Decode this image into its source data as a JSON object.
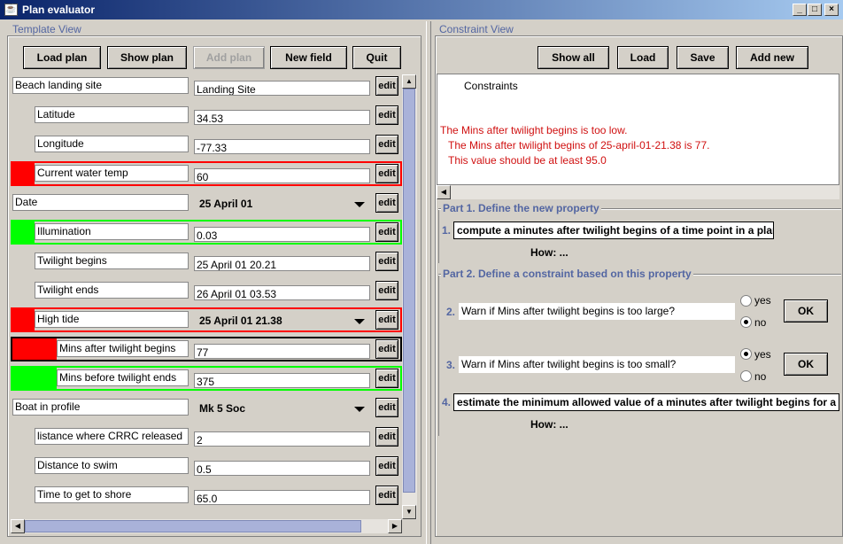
{
  "window": {
    "title": "Plan evaluator",
    "icon": "java-cup-icon"
  },
  "template_view": {
    "title": "Template View",
    "buttons": [
      "Load plan",
      "Show plan",
      "Add plan",
      "New field",
      "Quit"
    ],
    "edit_label": "edit",
    "rows": [
      {
        "label": "Beach landing site",
        "value": "Landing Site",
        "type": "text",
        "indent": 0,
        "status": "none"
      },
      {
        "label": "Latitude",
        "value": "34.53",
        "type": "text",
        "indent": 1,
        "status": "none"
      },
      {
        "label": "Longitude",
        "value": "-77.33",
        "type": "text",
        "indent": 1,
        "status": "none"
      },
      {
        "label": "Current water temp",
        "value": "60",
        "type": "text",
        "indent": 1,
        "status": "red"
      },
      {
        "label": "Date",
        "value": "25 April 01",
        "type": "combo",
        "indent": 0,
        "status": "none"
      },
      {
        "label": "Illumination",
        "value": "0.03",
        "type": "text",
        "indent": 1,
        "status": "green"
      },
      {
        "label": "Twilight begins",
        "value": "25 April 01 20.21",
        "type": "text",
        "indent": 1,
        "status": "none"
      },
      {
        "label": "Twilight ends",
        "value": "26 April 01 03.53",
        "type": "text",
        "indent": 1,
        "status": "none"
      },
      {
        "label": "High tide",
        "value": "25 April 01 21.38",
        "type": "combo",
        "indent": 1,
        "status": "red"
      },
      {
        "label": "Mins after twilight begins",
        "value": "77",
        "type": "text",
        "indent": 2,
        "status": "red-selected"
      },
      {
        "label": "Mins before twilight ends",
        "value": "375",
        "type": "text",
        "indent": 2,
        "status": "green"
      },
      {
        "label": "Boat in profile",
        "value": "Mk 5 Soc",
        "type": "combo",
        "indent": 0,
        "status": "none"
      },
      {
        "label": "listance where CRRC released",
        "value": "2",
        "type": "text",
        "indent": 1,
        "status": "none"
      },
      {
        "label": "Distance to swim",
        "value": "0.5",
        "type": "text",
        "indent": 1,
        "status": "none"
      },
      {
        "label": "Time to get to shore",
        "value": "65.0",
        "type": "text",
        "indent": 1,
        "status": "none"
      }
    ]
  },
  "constraint_view": {
    "title": "Constraint View",
    "buttons": [
      "Show all",
      "Load",
      "Save",
      "Add new"
    ],
    "text_heading": "Constraints",
    "messages": [
      "The Mins after twilight begins is too low.",
      "The Mins after twilight begins of 25-april-01-21.38 is 77.",
      "This value should be at least 95.0"
    ],
    "part1": {
      "title": "Part 1. Define the new property",
      "num": "1.",
      "text": "compute a minutes after twilight begins of a time point in a plan",
      "how": "How: ..."
    },
    "part2": {
      "title": "Part 2. Define a constraint based on this property",
      "q2": {
        "num": "2.",
        "text": "Warn if Mins after twilight begins is too large?",
        "yes": "yes",
        "no": "no",
        "selected": "no",
        "ok": "OK"
      },
      "q3": {
        "num": "3.",
        "text": "Warn if Mins after twilight begins is too small?",
        "yes": "yes",
        "no": "no",
        "selected": "yes",
        "ok": "OK"
      },
      "q4": {
        "num": "4.",
        "text": "estimate the minimum allowed value of a minutes after twilight begins for a time point in a plan"
      },
      "how": "How: ..."
    }
  },
  "colors": {
    "red": "#ff0000",
    "green": "#00ff00",
    "group_title": "#5366a2",
    "message": "#d01010"
  }
}
